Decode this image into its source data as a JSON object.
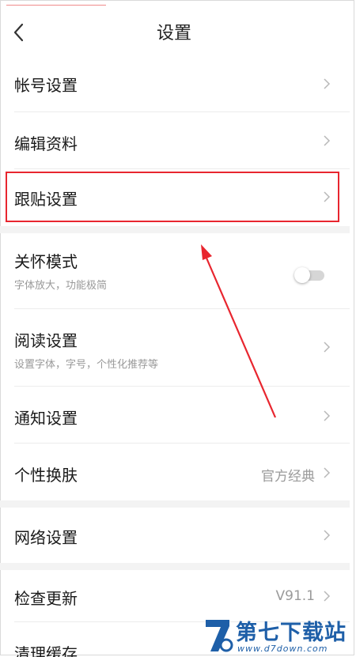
{
  "header": {
    "title": "设置",
    "back_icon": "chevron-left-icon"
  },
  "items": {
    "account": {
      "label": "帐号设置"
    },
    "edit_profile": {
      "label": "编辑资料"
    },
    "reply": {
      "label": "跟贴设置"
    },
    "care_mode": {
      "label": "关怀模式",
      "sub": "字体放大，功能极简",
      "toggle_on": false
    },
    "reading": {
      "label": "阅读设置",
      "sub": "设置字体，字号，个性化推荐等"
    },
    "notify": {
      "label": "通知设置"
    },
    "skin": {
      "label": "个性换肤",
      "value": "官方经典"
    },
    "network": {
      "label": "网络设置"
    },
    "update": {
      "label": "检查更新",
      "value": "V91.1"
    },
    "cache": {
      "label": "清理缓存"
    }
  },
  "watermark": {
    "name": "第七下载站",
    "url": "www.d7down.com"
  },
  "colors": {
    "highlight": "#e8262f",
    "watermark": "#1e5fa8",
    "section_gap": "#f3f3f3"
  }
}
